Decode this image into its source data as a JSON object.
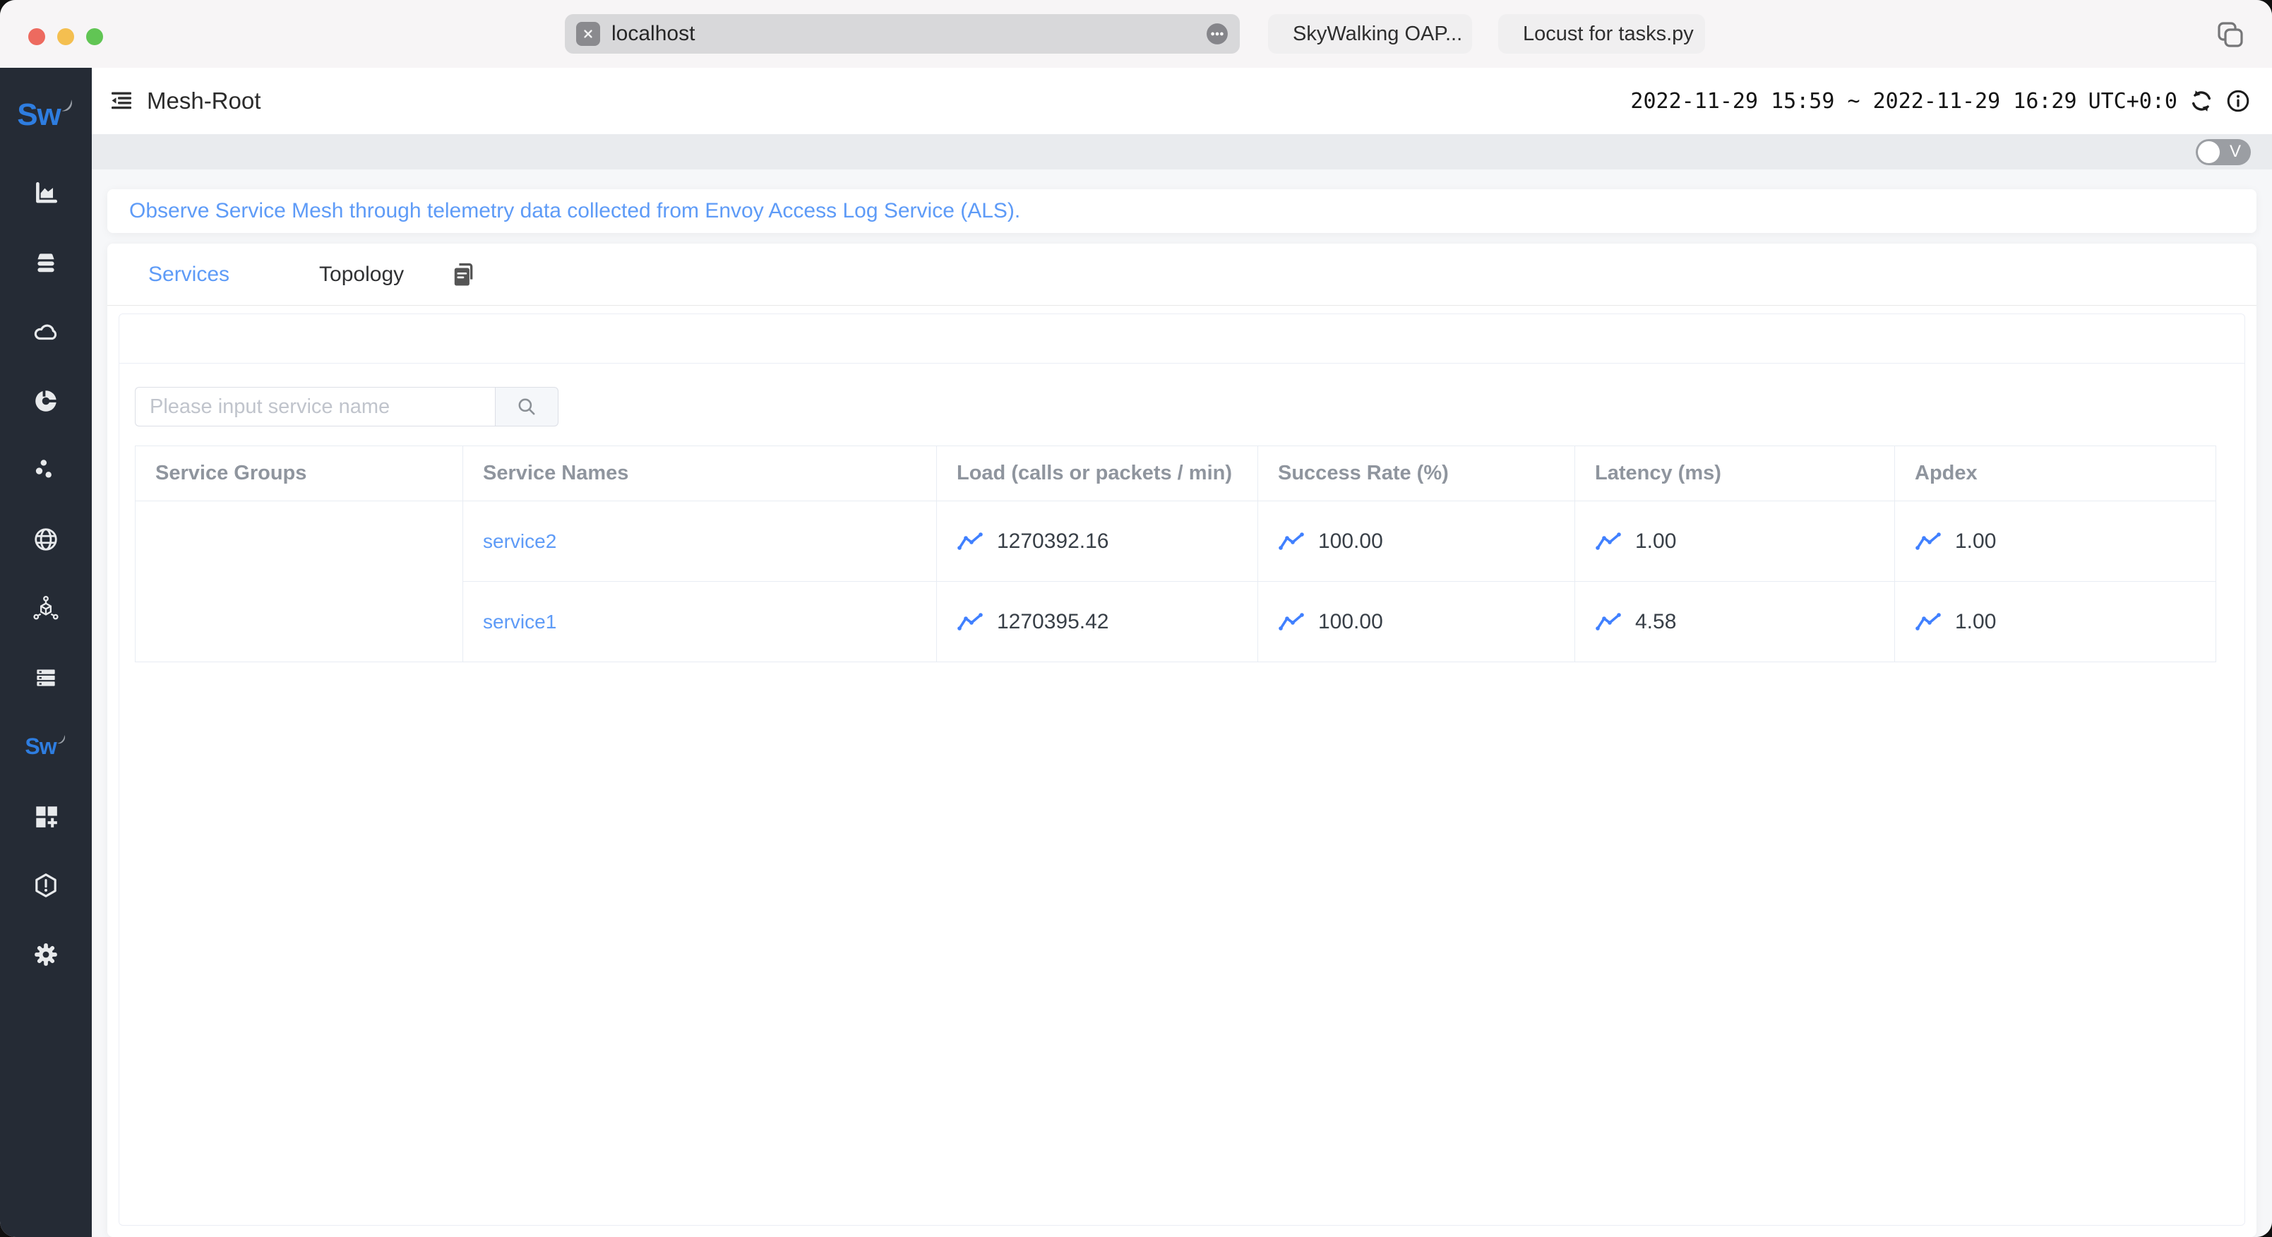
{
  "browser": {
    "address": {
      "url": "localhost"
    },
    "tabs": [
      {
        "label": "SkyWalking OAP...",
        "icon": "grafana-flame-icon"
      },
      {
        "label": "Locust for tasks.py",
        "icon": "locust-icon"
      }
    ]
  },
  "app_header": {
    "title": "Mesh-Root",
    "time_range": "2022-11-29 15:59 ~ 2022-11-29 16:29",
    "timezone": "UTC+0:0"
  },
  "toolbar": {
    "version_toggle": "V"
  },
  "sidebar": {
    "logo": "Sw",
    "items": [
      {
        "icon": "bar-chart-icon"
      },
      {
        "icon": "database-icon"
      },
      {
        "icon": "cloud-icon"
      },
      {
        "icon": "donut-chart-icon"
      },
      {
        "icon": "scatter-dots-icon"
      },
      {
        "icon": "globe-icon"
      },
      {
        "icon": "mesh-cube-icon"
      },
      {
        "icon": "server-list-icon"
      },
      {
        "icon": "skywalking-icon",
        "active": true
      },
      {
        "icon": "dashboard-add-icon"
      },
      {
        "icon": "alert-icon"
      },
      {
        "icon": "settings-gear-icon"
      }
    ]
  },
  "notice": {
    "text": "Observe Service Mesh through telemetry data collected from Envoy Access Log Service (ALS)."
  },
  "tabs": [
    {
      "label": "Services",
      "active": true
    },
    {
      "label": "Topology",
      "active": false
    }
  ],
  "search": {
    "placeholder": "Please input service name"
  },
  "services_table": {
    "columns": [
      "Service Groups",
      "Service Names",
      "Load (calls or packets / min)",
      "Success Rate (%)",
      "Latency (ms)",
      "Apdex"
    ],
    "rows": [
      {
        "group": "",
        "name": "service2",
        "load": "1270392.16",
        "success_rate": "100.00",
        "latency": "1.00",
        "apdex": "1.00"
      },
      {
        "group": "",
        "name": "service1",
        "load": "1270395.42",
        "success_rate": "100.00",
        "latency": "4.58",
        "apdex": "1.00"
      }
    ]
  },
  "colors": {
    "primary_blue": "#5e9bf7",
    "sparkline_blue": "#4080ff",
    "sidebar_bg": "#252b35",
    "logo_blue": "#2e7de0",
    "traffic_red": "#ed6a5f",
    "traffic_yellow": "#f4bf50",
    "traffic_green": "#61c554"
  }
}
